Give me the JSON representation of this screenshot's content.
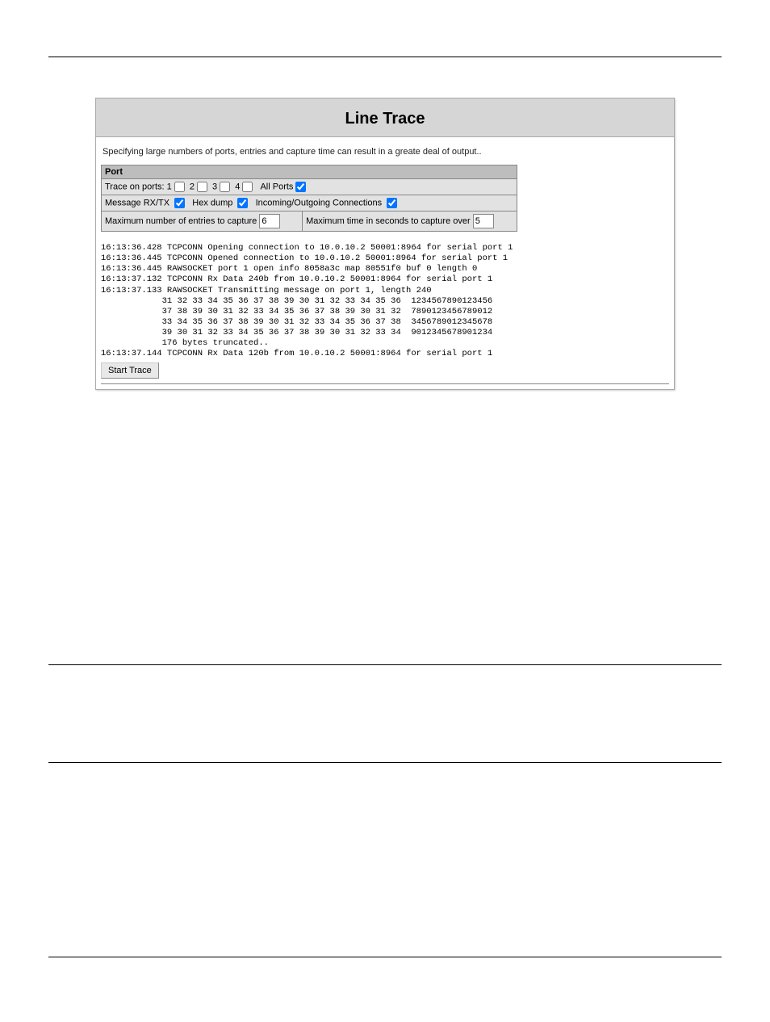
{
  "header": {
    "title": "Line Trace"
  },
  "note": "Specifying large numbers of ports, entries and capture time can result in a greate deal of output..",
  "portSection": {
    "heading": "Port",
    "row1": {
      "label": "Trace on ports:",
      "p1": "1",
      "p2": "2",
      "p3": "3",
      "p4": "4",
      "allPorts": "All Ports"
    },
    "row2": {
      "msgRxTx": "Message RX/TX",
      "hexDump": "Hex dump",
      "connections": "Incoming/Outgoing Connections"
    },
    "row3": {
      "maxEntriesLabel": "Maximum number of entries to capture",
      "maxEntriesValue": "6",
      "maxTimeLabel": "Maximum time in seconds to capture over",
      "maxTimeValue": "5"
    }
  },
  "trace": {
    "lines": "16:13:36.428 TCPCONN Opening connection to 10.0.10.2 50001:8964 for serial port 1\n16:13:36.445 TCPCONN Opened connection to 10.0.10.2 50001:8964 for serial port 1\n16:13:36.445 RAWSOCKET port 1 open info 8058a3c map 80551f0 buf 0 length 0\n16:13:37.132 TCPCONN Rx Data 240b from 10.0.10.2 50001:8964 for serial port 1\n16:13:37.133 RAWSOCKET Transmitting message on port 1, length 240\n            31 32 33 34 35 36 37 38 39 30 31 32 33 34 35 36  1234567890123456\n            37 38 39 30 31 32 33 34 35 36 37 38 39 30 31 32  7890123456789012\n            33 34 35 36 37 38 39 30 31 32 33 34 35 36 37 38  3456789012345678\n            39 30 31 32 33 34 35 36 37 38 39 30 31 32 33 34  9012345678901234\n            176 bytes truncated..\n16:13:37.144 TCPCONN Rx Data 120b from 10.0.10.2 50001:8964 for serial port 1"
  },
  "buttons": {
    "startTrace": "Start Trace"
  }
}
